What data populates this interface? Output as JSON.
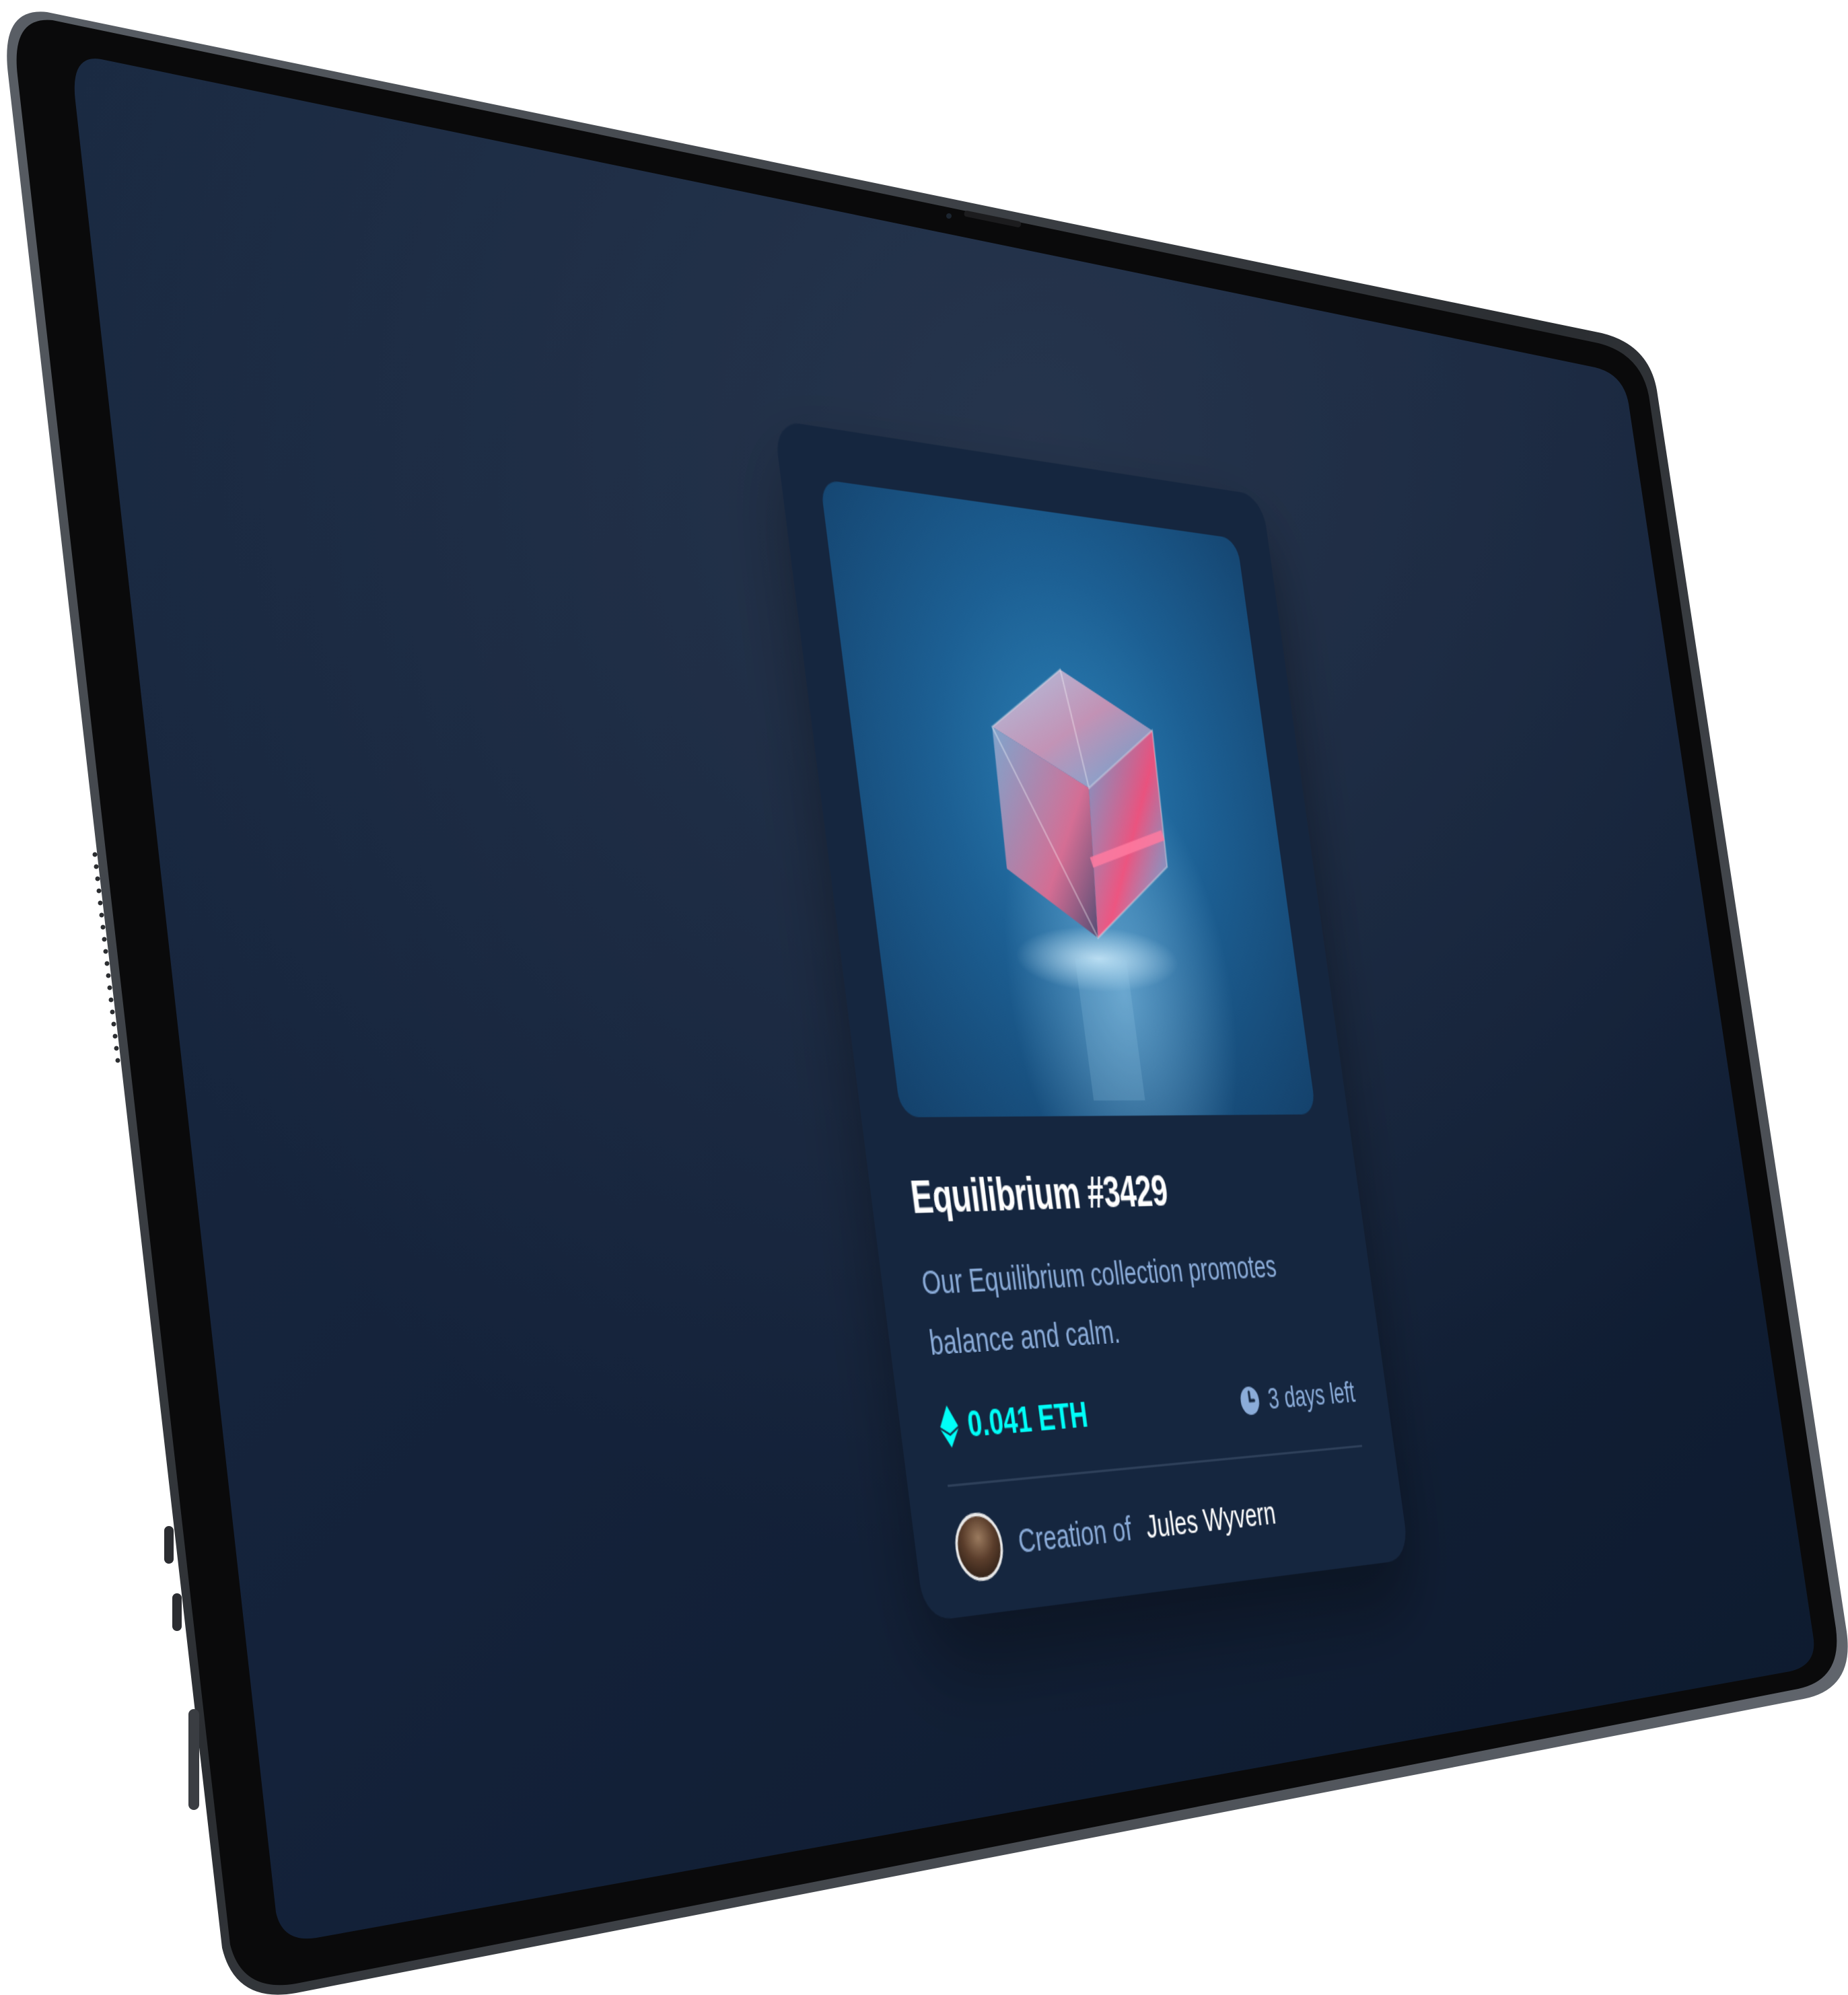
{
  "card": {
    "title": "Equilibrium #3429",
    "description": "Our Equilibrium collection promotes balance and calm.",
    "price": "0.041 ETH",
    "time_left": "3 days left",
    "creator_prefix": "Creation of",
    "creator_name": "Jules Wyvern",
    "image_alt": "Equilibrium NFT - glass cube"
  },
  "icons": {
    "price_icon": "ethereum-icon",
    "time_icon": "clock-icon"
  },
  "colors": {
    "screen_background": "#0d1a2e",
    "card_background": "#15263f",
    "accent_cyan": "#00fff8",
    "soft_blue_text": "#8bacd9",
    "white": "#ffffff"
  }
}
